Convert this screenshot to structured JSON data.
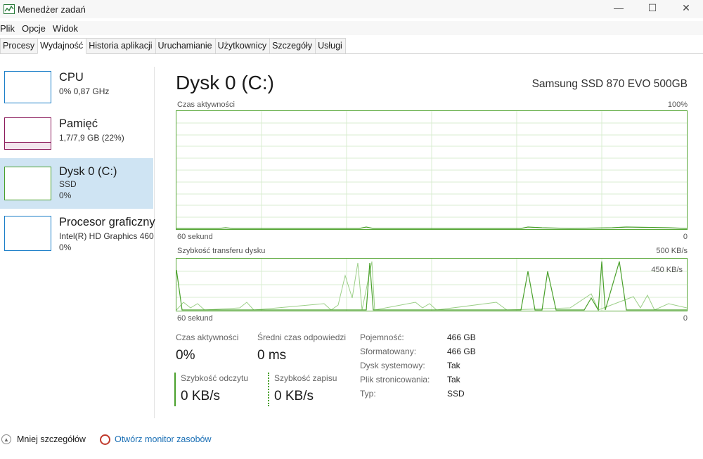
{
  "window": {
    "title": "Menedżer zadań",
    "minimize_glyph": "—",
    "maximize_glyph": "☐",
    "close_glyph": "✕"
  },
  "menu": [
    "Plik",
    "Opcje",
    "Widok"
  ],
  "tabs": [
    "Procesy",
    "Wydajność",
    "Historia aplikacji",
    "Uruchamianie",
    "Użytkownicy",
    "Szczegóły",
    "Usługi"
  ],
  "active_tab": "Wydajność",
  "sidebar": {
    "items": [
      {
        "name": "CPU",
        "line1": "0% 0,87 GHz",
        "line2": ""
      },
      {
        "name": "Pamięć",
        "line1": "1,7/7,9 GB (22%)",
        "line2": "",
        "usage_fraction": 0.22
      },
      {
        "name": "Dysk 0 (C:)",
        "line1": "SSD",
        "line2": "0%"
      },
      {
        "name": "Procesor graficzny",
        "line1": "Intel(R) HD Graphics 460",
        "line2": "0%"
      }
    ],
    "selected_index": 2
  },
  "main": {
    "title": "Dysk 0 (C:)",
    "device": "Samsung SSD 870 EVO 500GB",
    "graph1": {
      "label": "Czas aktywności",
      "max_label": "100%",
      "time_label": "60 sekund",
      "min_label": "0"
    },
    "graph2": {
      "label": "Szybkość transferu dysku",
      "max_label": "500 KB/s",
      "inner_label": "450 KB/s",
      "time_label": "60 sekund",
      "min_label": "0"
    },
    "stats": {
      "active_time_label": "Czas aktywności",
      "active_time_value": "0%",
      "avg_response_label": "Średni czas odpowiedzi",
      "avg_response_value": "0 ms",
      "read_speed_label": "Szybkość odczytu",
      "read_speed_value": "0 KB/s",
      "write_speed_label": "Szybkość zapisu",
      "write_speed_value": "0 KB/s"
    },
    "properties": [
      {
        "label": "Pojemność:",
        "value": "466 GB"
      },
      {
        "label": "Sformatowany:",
        "value": "466 GB"
      },
      {
        "label": "Dysk systemowy:",
        "value": "Tak"
      },
      {
        "label": "Plik stronicowania:",
        "value": "Tak"
      },
      {
        "label": "Typ:",
        "value": "SSD"
      }
    ]
  },
  "footer": {
    "fewer_details": "Mniej szczegółów",
    "open_monitor": "Otwórz monitor zasobów"
  },
  "colors": {
    "disk_green": "#4aa02c",
    "cpu_blue": "#1b7ec8",
    "memory_purple": "#8b1a5a",
    "selected_bg": "#cfe4f3",
    "link_blue": "#1a6fb5"
  }
}
